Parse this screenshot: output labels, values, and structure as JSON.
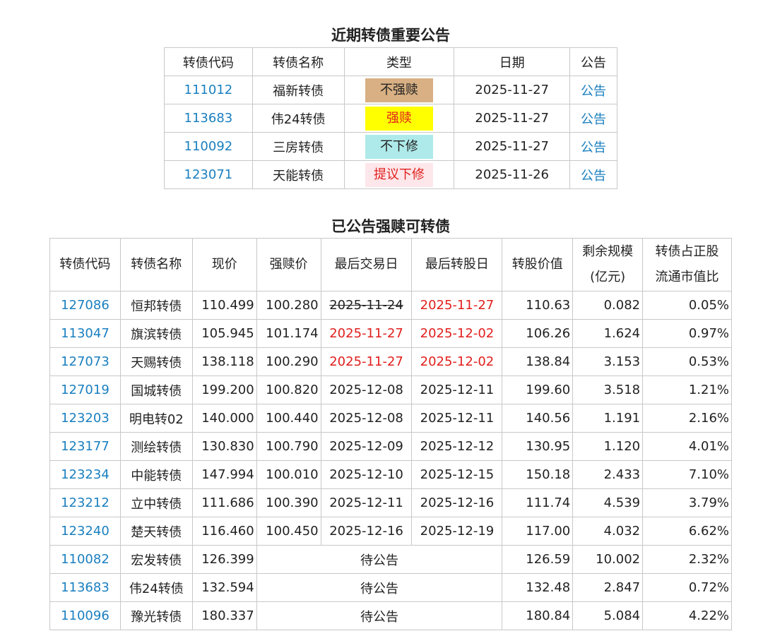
{
  "section1": {
    "title": "近期转债重要公告",
    "headers": [
      "转债代码",
      "转债名称",
      "类型",
      "日期",
      "公告"
    ],
    "rows": [
      {
        "code": "111012",
        "name": "福新转债",
        "type": "不强赎",
        "date": "2025-11-27",
        "notice": "公告"
      },
      {
        "code": "113683",
        "name": "伟24转债",
        "type": "强赎",
        "date": "2025-11-27",
        "notice": "公告"
      },
      {
        "code": "110092",
        "name": "三房转债",
        "type": "不下修",
        "date": "2025-11-27",
        "notice": "公告"
      },
      {
        "code": "123071",
        "name": "天能转债",
        "type": "提议下修",
        "date": "2025-11-26",
        "notice": "公告"
      }
    ],
    "type_colors": {
      "不强赎": {
        "bg": "#d8b083",
        "fg": "#222222"
      },
      "强赎": {
        "bg": "#ffff00",
        "fg": "#e0201d"
      },
      "不下修": {
        "bg": "#aeeaea",
        "fg": "#222222"
      },
      "提议下修": {
        "bg": "#fde7ea",
        "fg": "#e0201d"
      }
    }
  },
  "section2": {
    "title": "已公告强赎可转债",
    "headers": {
      "code": "转债代码",
      "name": "转债名称",
      "price": "现价",
      "redeem_price": "强赎价",
      "last_trade": "最后交易日",
      "last_convert": "最后转股日",
      "convert_value": "转股价值",
      "remaining_l1": "剩余规模",
      "remaining_l2": "(亿元)",
      "ratio_l1": "转债占正股",
      "ratio_l2": "流通市值比"
    },
    "pending_label": "待公告",
    "rows": [
      {
        "code": "127086",
        "name": "恒邦转债",
        "price": "110.499",
        "redeem_price": "100.280",
        "last_trade": "2025-11-24",
        "last_trade_style": "strike",
        "last_convert": "2025-11-27",
        "last_convert_style": "red",
        "convert_value": "110.63",
        "remaining": "0.082",
        "ratio": "0.05%"
      },
      {
        "code": "113047",
        "name": "旗滨转债",
        "price": "105.945",
        "redeem_price": "101.174",
        "last_trade": "2025-11-27",
        "last_trade_style": "red",
        "last_convert": "2025-12-02",
        "last_convert_style": "red",
        "convert_value": "106.26",
        "remaining": "1.624",
        "ratio": "0.97%"
      },
      {
        "code": "127073",
        "name": "天赐转债",
        "price": "138.118",
        "redeem_price": "100.290",
        "last_trade": "2025-11-27",
        "last_trade_style": "red",
        "last_convert": "2025-12-02",
        "last_convert_style": "red",
        "convert_value": "138.84",
        "remaining": "3.153",
        "ratio": "0.53%"
      },
      {
        "code": "127019",
        "name": "国城转债",
        "price": "199.200",
        "redeem_price": "100.820",
        "last_trade": "2025-12-08",
        "last_trade_style": "",
        "last_convert": "2025-12-11",
        "last_convert_style": "",
        "convert_value": "199.60",
        "remaining": "3.518",
        "ratio": "1.21%"
      },
      {
        "code": "123203",
        "name": "明电转02",
        "price": "140.000",
        "redeem_price": "100.440",
        "last_trade": "2025-12-08",
        "last_trade_style": "",
        "last_convert": "2025-12-11",
        "last_convert_style": "",
        "convert_value": "140.56",
        "remaining": "1.191",
        "ratio": "2.16%"
      },
      {
        "code": "123177",
        "name": "测绘转债",
        "price": "130.830",
        "redeem_price": "100.790",
        "last_trade": "2025-12-09",
        "last_trade_style": "",
        "last_convert": "2025-12-12",
        "last_convert_style": "",
        "convert_value": "130.95",
        "remaining": "1.120",
        "ratio": "4.01%"
      },
      {
        "code": "123234",
        "name": "中能转债",
        "price": "147.994",
        "redeem_price": "100.010",
        "last_trade": "2025-12-10",
        "last_trade_style": "",
        "last_convert": "2025-12-15",
        "last_convert_style": "",
        "convert_value": "150.18",
        "remaining": "2.433",
        "ratio": "7.10%"
      },
      {
        "code": "123212",
        "name": "立中转债",
        "price": "111.686",
        "redeem_price": "100.390",
        "last_trade": "2025-12-11",
        "last_trade_style": "",
        "last_convert": "2025-12-16",
        "last_convert_style": "",
        "convert_value": "111.74",
        "remaining": "4.539",
        "ratio": "3.79%"
      },
      {
        "code": "123240",
        "name": "楚天转债",
        "price": "116.460",
        "redeem_price": "100.450",
        "last_trade": "2025-12-16",
        "last_trade_style": "",
        "last_convert": "2025-12-19",
        "last_convert_style": "",
        "convert_value": "117.00",
        "remaining": "4.032",
        "ratio": "6.62%"
      },
      {
        "code": "110082",
        "name": "宏发转债",
        "price": "126.399",
        "pending": true,
        "convert_value": "126.59",
        "remaining": "10.002",
        "ratio": "2.32%"
      },
      {
        "code": "113683",
        "name": "伟24转债",
        "price": "132.594",
        "pending": true,
        "convert_value": "132.48",
        "remaining": "2.847",
        "ratio": "0.72%"
      },
      {
        "code": "110096",
        "name": "豫光转债",
        "price": "180.337",
        "pending": true,
        "convert_value": "180.84",
        "remaining": "5.084",
        "ratio": "4.22%"
      }
    ]
  }
}
